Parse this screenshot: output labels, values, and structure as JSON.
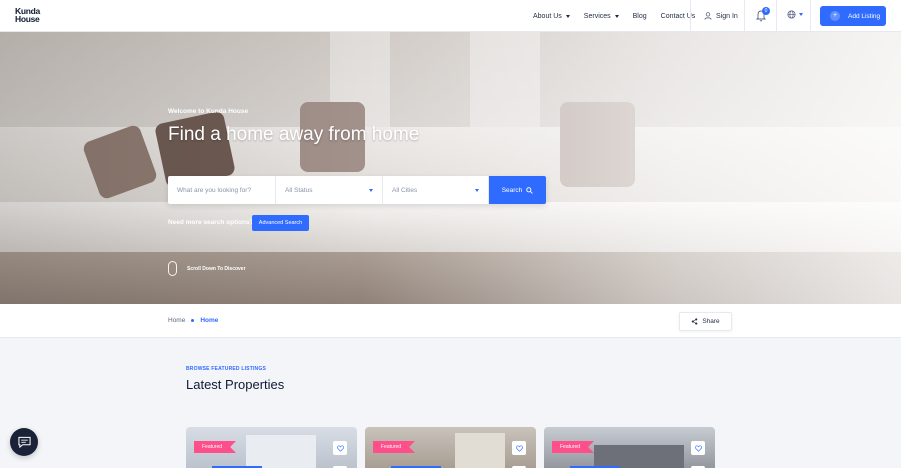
{
  "header": {
    "logo_line1": "Kunda",
    "logo_line2": "House",
    "nav": [
      {
        "label": "About Us",
        "has_dropdown": true
      },
      {
        "label": "Services",
        "has_dropdown": true
      },
      {
        "label": "Blog",
        "has_dropdown": false
      },
      {
        "label": "Contact Us",
        "has_dropdown": false
      }
    ],
    "signin_label": "Sign In",
    "notification_count": "0",
    "add_listing_label": "Add Listing"
  },
  "hero": {
    "welcome": "Welcome to Kunda House",
    "title": "Find a home away from home",
    "search": {
      "keyword_placeholder": "What are you looking for?",
      "status_value": "All Status",
      "city_value": "All Cities",
      "button_label": "Search"
    },
    "more_options": "Need more search options?",
    "advanced_label": "Advanced Search",
    "scroll_label": "Scroll Down To Discover"
  },
  "breadcrumb": {
    "items": [
      "Home",
      "Home"
    ],
    "share_label": "Share"
  },
  "listings": {
    "eyebrow": "BROWSE FEATURED LISTINGS",
    "title": "Latest Properties",
    "cards": [
      {
        "badge": "Featured"
      },
      {
        "badge": "Featured"
      },
      {
        "badge": "Featured"
      }
    ]
  },
  "colors": {
    "accent": "#2f6bff",
    "featured": "#ff4f8b",
    "dark": "#0f1a33"
  }
}
